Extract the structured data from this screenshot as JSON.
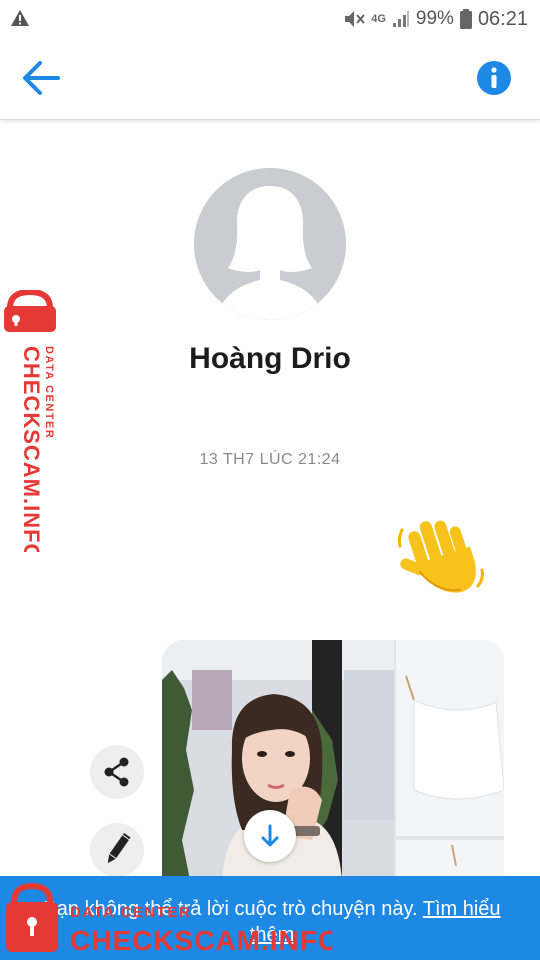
{
  "status_bar": {
    "network": "4G",
    "battery": "99%",
    "time": "06:21",
    "icons": [
      "warning-icon",
      "mute-icon",
      "signal-icon",
      "battery-icon"
    ]
  },
  "toolbar": {
    "back_icon": "arrow-left-icon",
    "info_icon": "info-icon",
    "accent_color": "#1e88e5"
  },
  "profile": {
    "name": "Hoàng Drio",
    "avatar_icon": "default-avatar-icon"
  },
  "conversation": {
    "timestamp": "13 TH7 LÚC 21:24",
    "messages": [
      {
        "type": "emoji",
        "icon": "waving-hand-icon"
      },
      {
        "type": "photo",
        "actions": [
          "share-icon",
          "edit-icon",
          "download-icon"
        ]
      }
    ]
  },
  "banner": {
    "text": "Bạn không thể trả lời cuộc trò chuyện này.",
    "link": "Tìm hiểu thêm",
    "background": "#1e88e5"
  },
  "watermark": {
    "brand": "CHECKSCAM.INFO",
    "tag": "DATA CENTER",
    "color": "#e53935"
  }
}
